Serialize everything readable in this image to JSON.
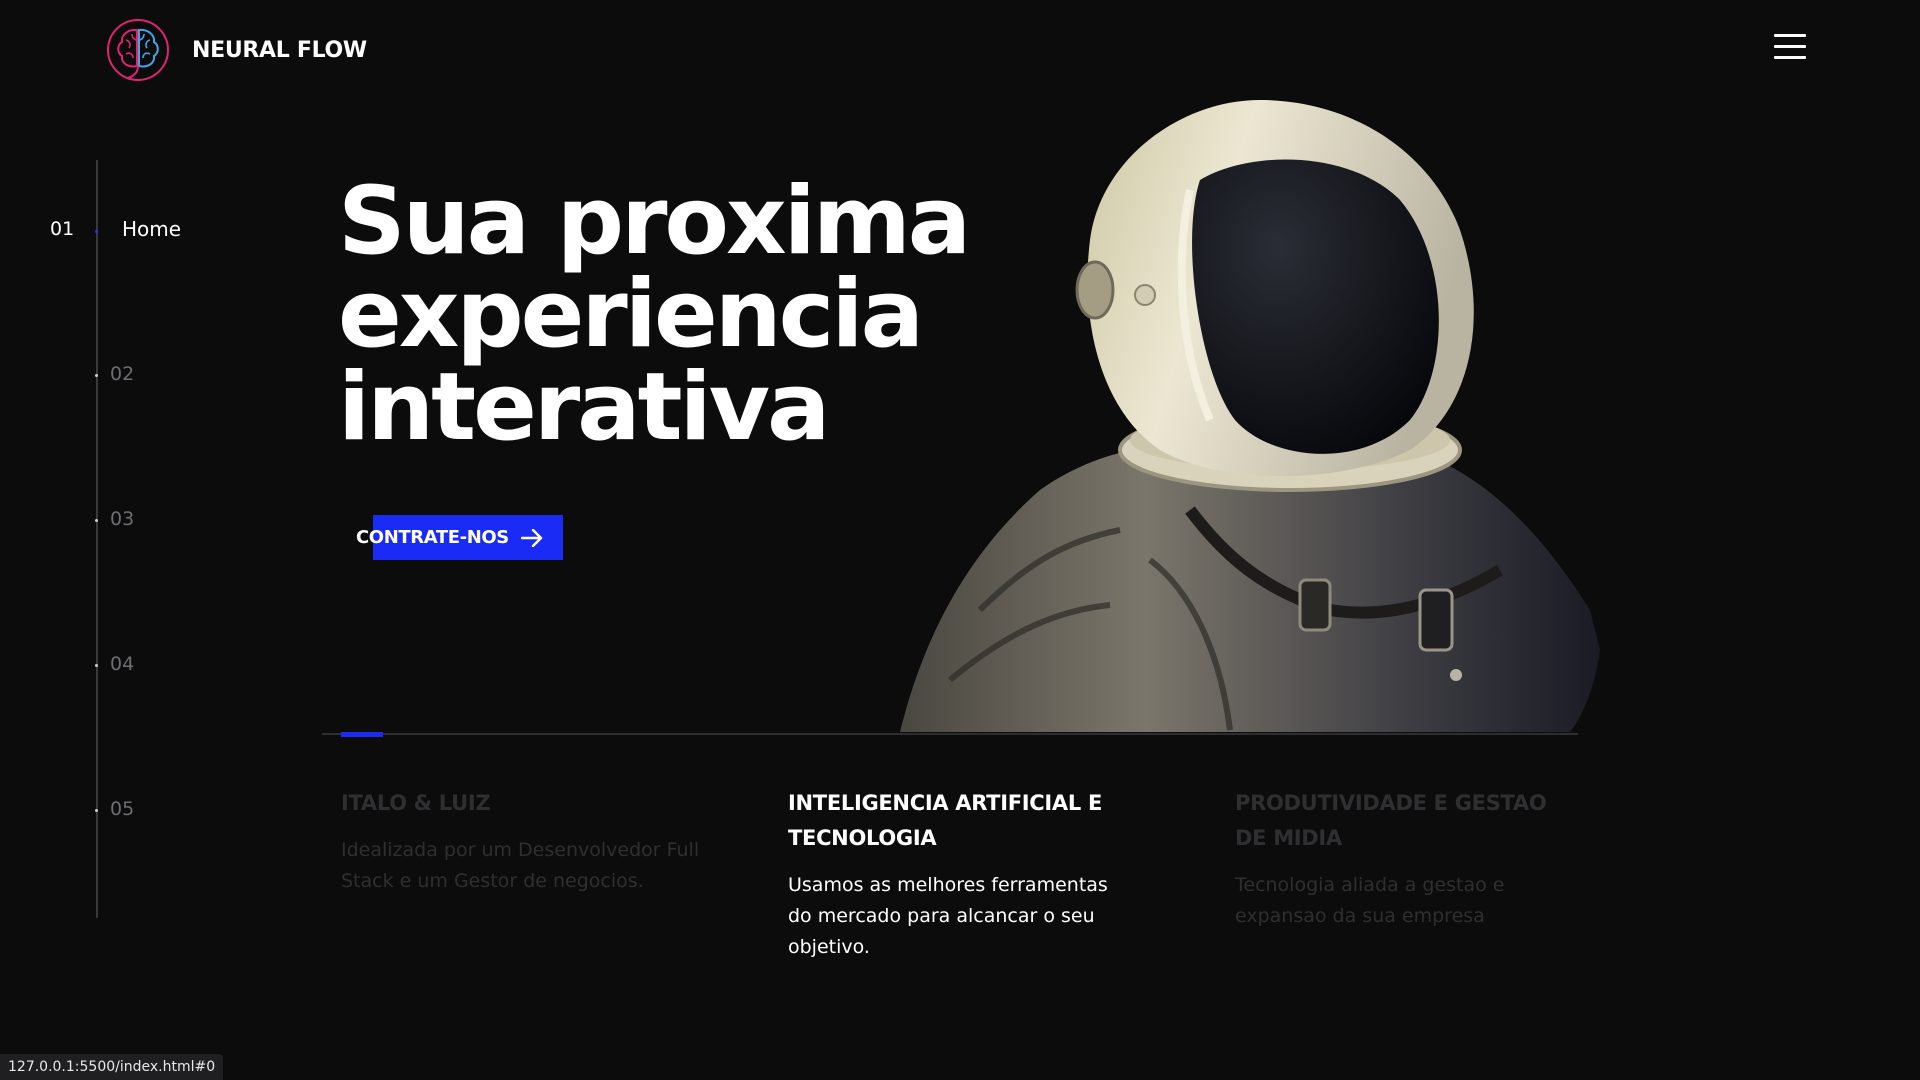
{
  "header": {
    "brand": "NEURAL FLOW",
    "logo_icon": "brain-circle-logo",
    "menu_icon": "hamburger-menu-icon"
  },
  "side_nav": {
    "items": [
      {
        "number": "01",
        "label": "Home",
        "active": true
      },
      {
        "number": "02",
        "label": "",
        "active": false
      },
      {
        "number": "03",
        "label": "",
        "active": false
      },
      {
        "number": "04",
        "label": "",
        "active": false
      },
      {
        "number": "05",
        "label": "",
        "active": false
      }
    ]
  },
  "hero": {
    "title_line1": "Sua proxima",
    "title_line2": "experiencia",
    "title_line3": "interativa",
    "cta_label": "CONTRATE-NOS",
    "cta_icon": "arrow-right-icon",
    "image": "astronaut-helmet-photo"
  },
  "progress": {
    "current": 1,
    "total": 5
  },
  "features": [
    {
      "title": "ITALO & LUIZ",
      "text": "Idealizada por um Desenvolvedor Full Stack e um Gestor de negocios.",
      "active": false
    },
    {
      "title": "INTELIGENCIA ARTIFICIAL E TECNOLOGIA",
      "text": "Usamos as melhores ferramentas do mercado para alcancar o seu objetivo.",
      "active": true
    },
    {
      "title": "PRODUTIVIDADE E GESTAO DE MIDIA",
      "text": "Tecnologia aliada a gestao e expansao da sua empresa",
      "active": false
    }
  ],
  "status_bar": {
    "url": "127.0.0.1:5500/index.html#0"
  },
  "colors": {
    "background": "#0c0c0d",
    "accent": "#1a2bf5",
    "logo_pink": "#e0246e",
    "logo_blue": "#3fa8e8"
  }
}
